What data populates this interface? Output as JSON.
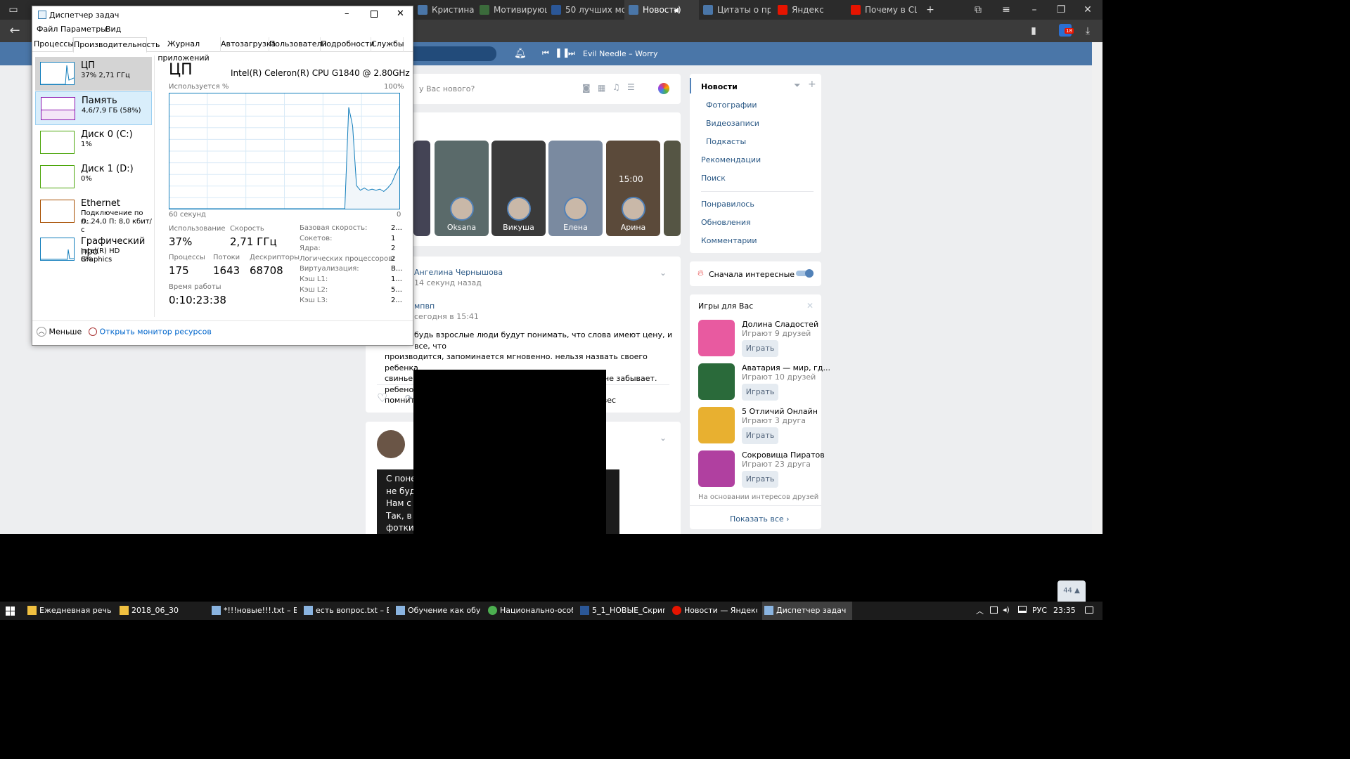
{
  "browser": {
    "tabs": [
      {
        "label": "Кристина Мак",
        "color": "#4a76a8"
      },
      {
        "label": "Мотивирующ",
        "color": "#3b6b3b"
      },
      {
        "label": "50 лучших мот",
        "color": "#2b5797"
      },
      {
        "label": "Новости",
        "color": "#4a76a8",
        "active": true
      },
      {
        "label": "Цитаты о прир",
        "color": "#4a76a8"
      },
      {
        "label": "Яндекс",
        "color": "#e61400"
      },
      {
        "label": "Почему в США",
        "color": "#e61400"
      }
    ],
    "tabs_badge": "18"
  },
  "vk": {
    "search_placeholder": "",
    "player_track": "Evil Needle – Worry",
    "post_prompt": "у Вас нового?",
    "stories": [
      {
        "name": "Oksana",
        "bg": "#5a6a6a"
      },
      {
        "name": "Викуша",
        "bg": "#3a3a3a"
      },
      {
        "name": "Елена",
        "bg": "#7a8aa0"
      },
      {
        "name": "Арина",
        "bg": "#5b4a3a"
      }
    ],
    "story_clock": "15:00",
    "post1": {
      "author": "Ангелина Чернышова",
      "time": "14 секунд назад",
      "group": "мпвп",
      "group_time": "сегодня в 15:41",
      "text_lines": [
        "будь взрослые люди будут понимать, что слова имеют цену, и все, что",
        "производится, запоминается мгновенно. нельзя назвать своего ребенка",
        "свиньей или сукой, а потом забыть об этом. ребенок не забывает. ребенок",
        "помнит, прокручивает в голове, верит. слова имеют вес"
      ]
    },
    "post2_lines": [
      "С поне",
      "не буд",
      "Нам с",
      "Так, в",
      "фотки"
    ],
    "right_menu": [
      {
        "label": "Новости",
        "active": true
      },
      {
        "label": "Фотографии",
        "sub": true
      },
      {
        "label": "Видеозаписи",
        "sub": true
      },
      {
        "label": "Подкасты",
        "sub": true
      },
      {
        "label": "Рекомендации"
      },
      {
        "label": "Поиск"
      },
      {
        "label": "Понравилось"
      },
      {
        "label": "Обновления"
      },
      {
        "label": "Комментарии"
      }
    ],
    "interesting_first": "Сначала интересные",
    "games_title": "Игры для Вас",
    "games": [
      {
        "title": "Долина Сладостей",
        "sub": "Играют 9 друзей",
        "play": "Играть",
        "color": "#e85aa0"
      },
      {
        "title": "Аватария — мир, гд...",
        "sub": "Играют 10 друзей",
        "play": "Играть",
        "color": "#2a6a3a"
      },
      {
        "title": "5 Отличий Онлайн",
        "sub": "Играют 3 друга",
        "play": "Играть",
        "color": "#e8b030"
      },
      {
        "title": "Сокровища Пиратов",
        "sub": "Играют 23 друга",
        "play": "Играть",
        "color": "#b040a0"
      }
    ],
    "games_footer": "На основании интересов друзей",
    "show_all": "Показать все",
    "counter": "44"
  },
  "tm": {
    "title": "Диспетчер задач",
    "menu": [
      "Файл",
      "Параметры",
      "Вид"
    ],
    "tabs": [
      "Процессы",
      "Производительность",
      "Журнал приложений",
      "Автозагрузка",
      "Пользователи",
      "Подробности",
      "Службы"
    ],
    "side": [
      {
        "t1": "ЦП",
        "t2": "37% 2,71 ГГц",
        "color": "#117dbb"
      },
      {
        "t1": "Память",
        "t2": "4,6/7,9 ГБ (58%)",
        "color": "#8b12ae"
      },
      {
        "t1": "Диск 0 (C:)",
        "t2": "1%",
        "color": "#4da60c"
      },
      {
        "t1": "Диск 1 (D:)",
        "t2": "0%",
        "color": "#4da60c"
      },
      {
        "t1": "Ethernet",
        "t2": "Подключение по л...",
        "t3": "О: 24,0 П: 8,0 кбит/с",
        "color": "#a74f01"
      },
      {
        "t1": "Графический про",
        "t2": "Intel(R) HD Graphics",
        "t3": "8%",
        "color": "#117dbb"
      }
    ],
    "cpu_heading": "ЦП",
    "cpu_name": "Intel(R) Celeron(R) CPU G1840 @ 2.80GHz",
    "graph_ylabel": "Используется %",
    "graph_ymax": "100%",
    "graph_xleft": "60 секунд",
    "graph_xright": "0",
    "cpu_history": [
      0,
      0,
      0,
      0,
      0,
      0,
      0,
      0,
      0,
      0,
      0,
      0,
      0,
      0,
      0,
      0,
      0,
      0,
      0,
      0,
      0,
      0,
      0,
      0,
      0,
      0,
      0,
      0,
      0,
      0,
      0,
      0,
      0,
      0,
      0,
      0,
      0,
      0,
      0,
      0,
      0,
      0,
      0,
      0,
      0,
      0,
      88,
      72,
      20,
      16,
      18,
      16,
      17,
      16,
      17,
      15,
      18,
      22,
      30,
      37
    ],
    "stats": {
      "usage_label": "Использование",
      "usage": "37%",
      "speed_label": "Скорость",
      "speed": "2,71 ГГц",
      "proc_label": "Процессы",
      "proc": "175",
      "threads_label": "Потоки",
      "threads": "1643",
      "handles_label": "Дескрипторы",
      "handles": "68708",
      "uptime_label": "Время работы",
      "uptime": "0:10:23:38"
    },
    "details": [
      {
        "k": "Базовая скорость:",
        "v": "2..."
      },
      {
        "k": "Сокетов:",
        "v": "1"
      },
      {
        "k": "Ядра:",
        "v": "2"
      },
      {
        "k": "Логических процессоров:",
        "v": "2"
      },
      {
        "k": "Виртуализация:",
        "v": "В..."
      },
      {
        "k": "Кэш L1:",
        "v": "1..."
      },
      {
        "k": "Кэш L2:",
        "v": "5..."
      },
      {
        "k": "Кэш L3:",
        "v": "2..."
      }
    ],
    "fewer": "Меньше",
    "open_monitor": "Открыть монитор ресурсов"
  },
  "taskbar": {
    "items": [
      {
        "label": "Ежедневная речь",
        "color": "#f0c040"
      },
      {
        "label": "2018_06_30",
        "color": "#f0c040"
      },
      {
        "label": "*!!!новые!!!.txt – Блок...",
        "color": "#8ab4e0"
      },
      {
        "label": "есть вопрос.txt – Бл...",
        "color": "#8ab4e0"
      },
      {
        "label": "Обучение как обуча...",
        "color": "#8ab4e0"
      },
      {
        "label": "Национально-особ...",
        "color": "#4caf50"
      },
      {
        "label": "5_1_НОВЫЕ_Скрипт...",
        "color": "#2b5797"
      },
      {
        "label": "Новости — Яндекс.Б...",
        "color": "#e61400"
      },
      {
        "label": "Диспетчер задач",
        "color": "#8ab4e0",
        "active": true
      }
    ],
    "lang": "РУС",
    "time": "23:35"
  }
}
